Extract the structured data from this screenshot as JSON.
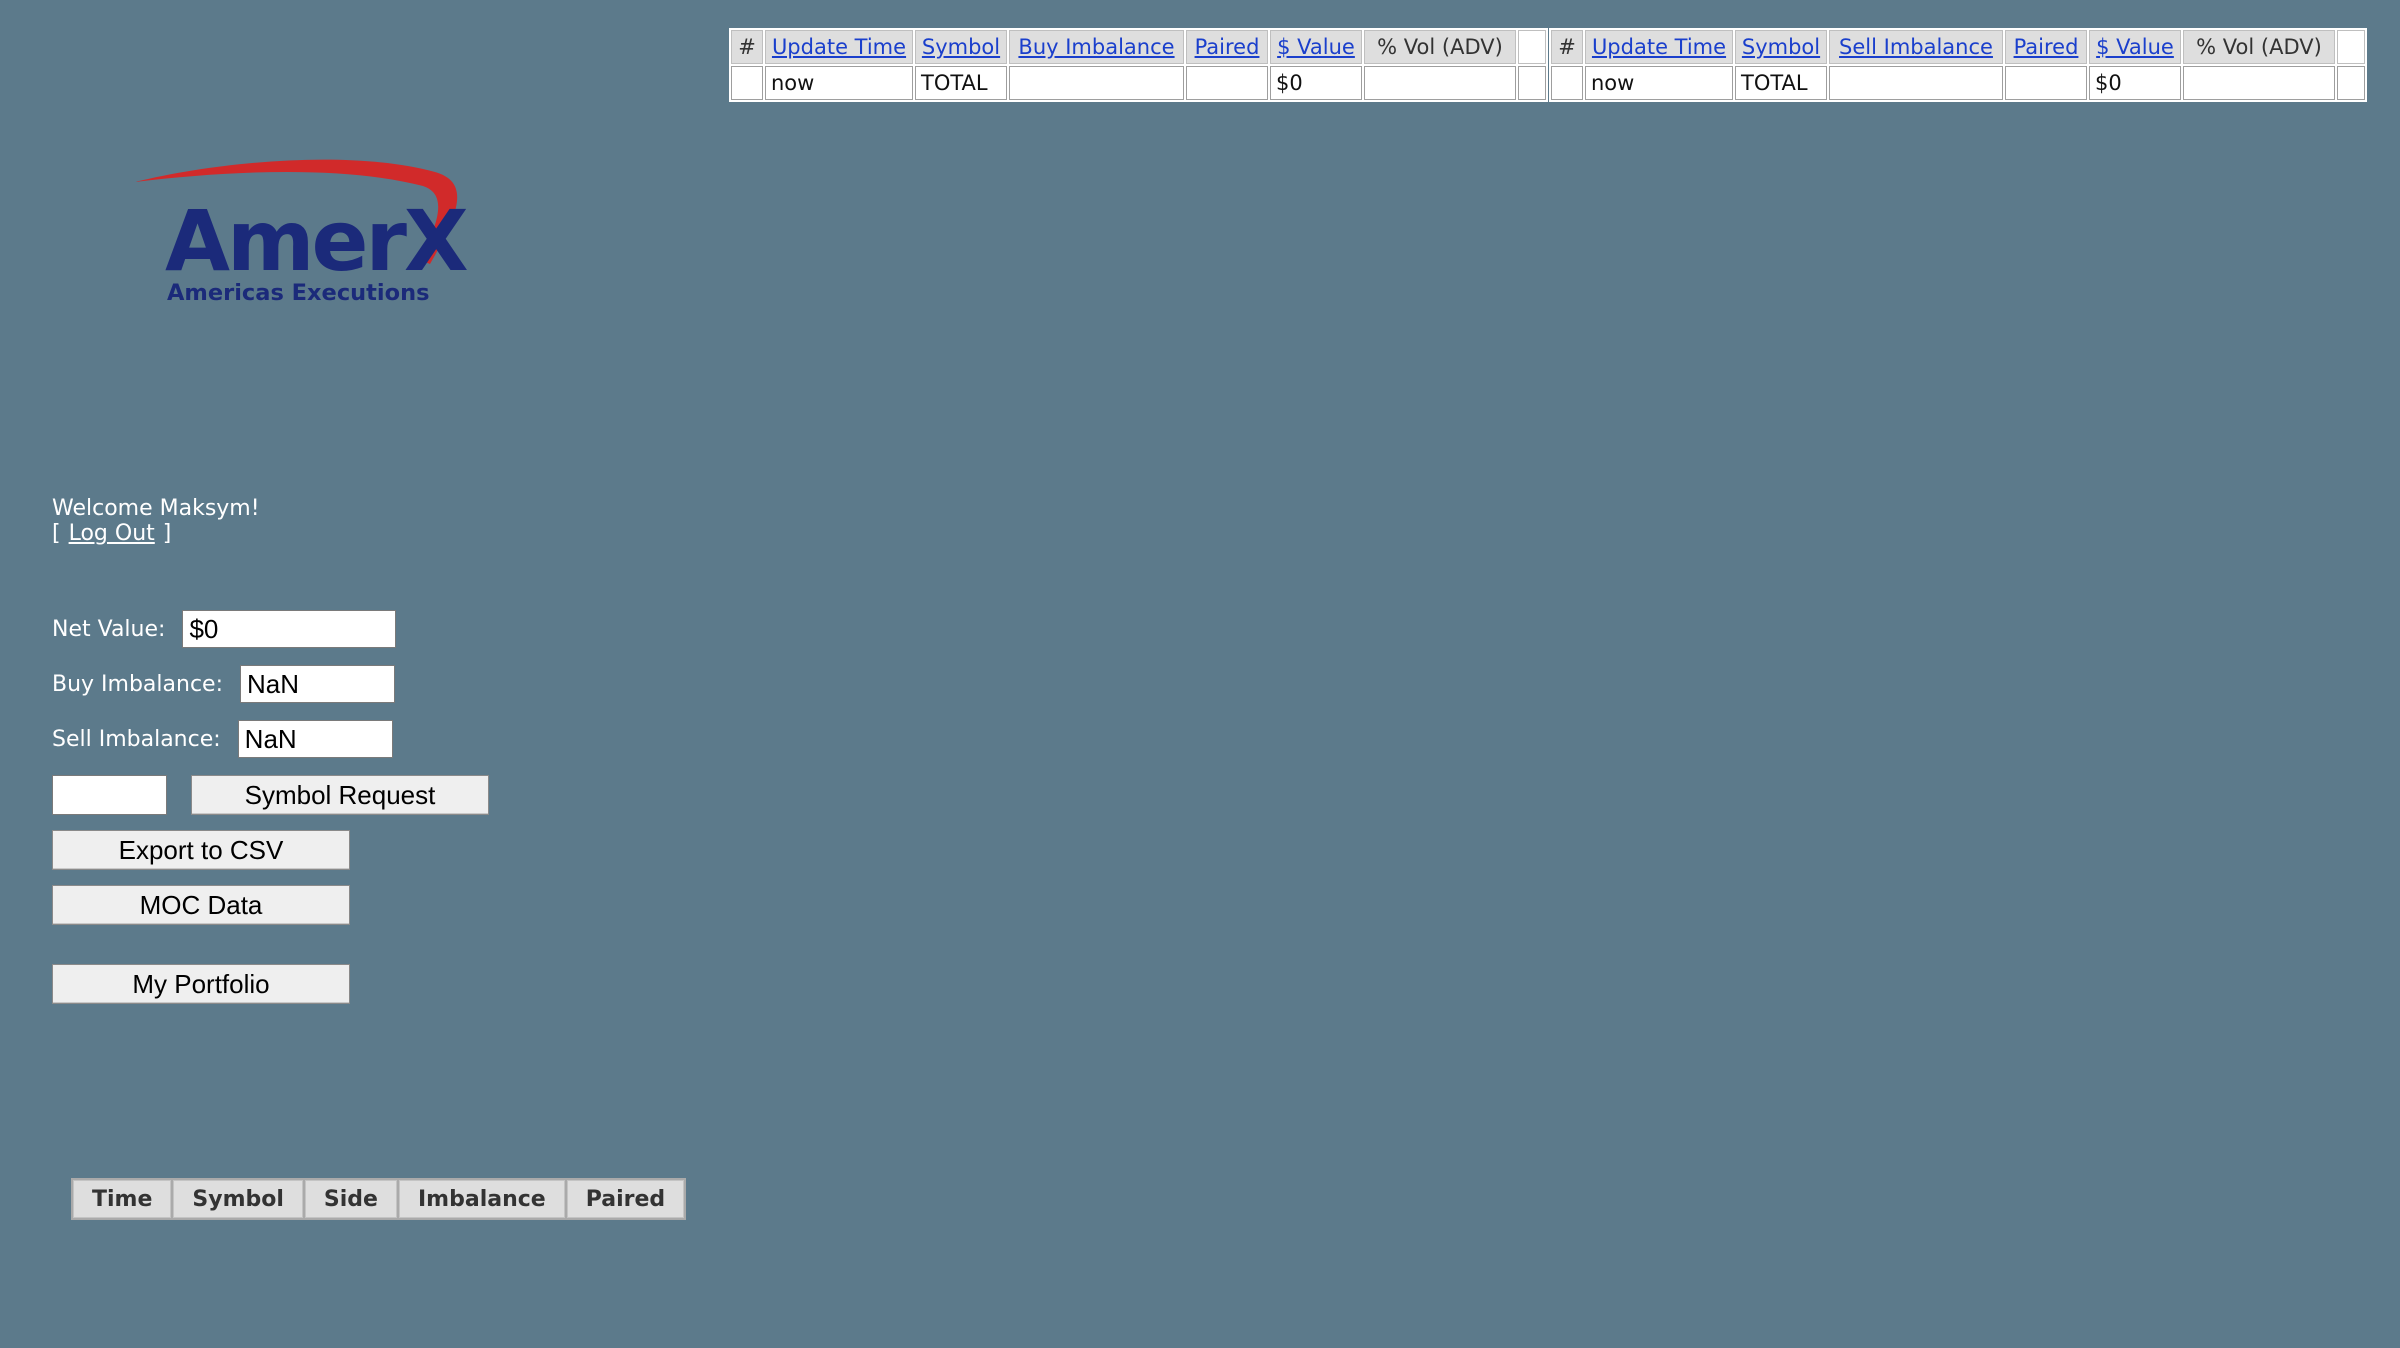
{
  "logo": {
    "name": "AmerX",
    "tagline": "Americas Executions",
    "colors": {
      "primary": "#1b2a7a",
      "accent": "#d12a2a"
    }
  },
  "user": {
    "welcome": "Welcome Maksym!",
    "logout_open": "[",
    "logout_label": "Log Out",
    "logout_close": "]"
  },
  "summary": {
    "net_value_label": "Net Value:",
    "net_value": "$0",
    "buy_imbalance_label": "Buy Imbalance:",
    "buy_imbalance": "NaN",
    "sell_imbalance_label": "Sell Imbalance:",
    "sell_imbalance": "NaN"
  },
  "controls": {
    "symbol_input_value": "",
    "symbol_request_label": "Symbol Request",
    "export_csv_label": "Export to CSV",
    "moc_data_label": "MOC Data",
    "my_portfolio_label": "My Portfolio"
  },
  "buy_table": {
    "headers": [
      "#",
      "Update Time",
      "Symbol",
      "Buy Imbalance",
      "Paired",
      "$ Value",
      "% Vol (ADV)",
      ""
    ],
    "total_row": [
      "",
      "now",
      "TOTAL",
      "",
      "",
      "$0",
      "",
      ""
    ]
  },
  "sell_table": {
    "headers": [
      "#",
      "Update Time",
      "Symbol",
      "Sell Imbalance",
      "Paired",
      "$ Value",
      "% Vol (ADV)",
      ""
    ],
    "total_row": [
      "",
      "now",
      "TOTAL",
      "",
      "",
      "$0",
      "",
      ""
    ]
  },
  "recent_table": {
    "headers": [
      "Time",
      "Symbol",
      "Side",
      "Imbalance",
      "Paired"
    ]
  },
  "colors": {
    "background": "#5c7a8b",
    "link": "#1a3fcc"
  }
}
